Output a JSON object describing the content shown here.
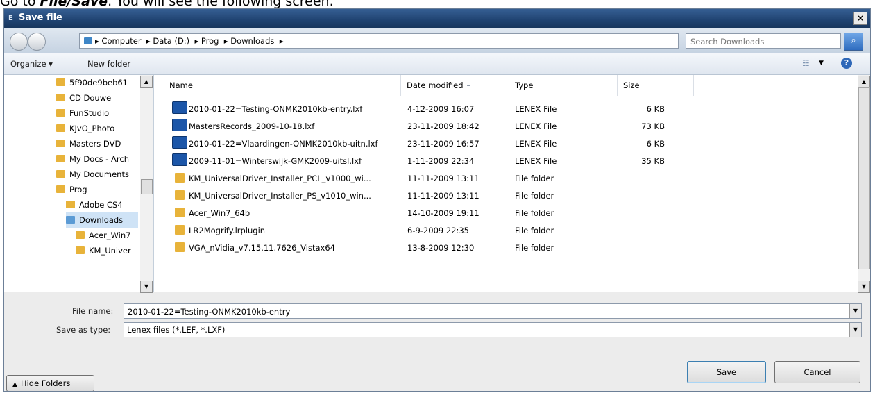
{
  "caption": {
    "prefix": "Go to ",
    "menu": "File/Save",
    "suffix": ". You will see the following screen."
  },
  "window": {
    "title": "Save file",
    "close": "×"
  },
  "address": {
    "crumbs": [
      "▸ Computer",
      "▸ Data (D:)",
      "▸ Prog",
      "▸ Downloads",
      "▸"
    ],
    "search_placeholder": "Search Downloads"
  },
  "toolbar": {
    "organize": "Organize ▾",
    "new_folder": "New folder",
    "help": "?"
  },
  "nav_tree": [
    {
      "label": "5f90de9beb61",
      "selected": false
    },
    {
      "label": "CD Douwe",
      "selected": false
    },
    {
      "label": "FunStudio",
      "selected": false
    },
    {
      "label": "KJvO_Photo",
      "selected": false
    },
    {
      "label": "Masters DVD",
      "selected": false
    },
    {
      "label": "My Docs - Arch",
      "selected": false
    },
    {
      "label": "My Documents",
      "selected": false
    },
    {
      "label": "Prog",
      "selected": false
    },
    {
      "label": "Adobe CS4",
      "selected": false
    },
    {
      "label": "Downloads",
      "selected": true
    },
    {
      "label": "Acer_Win7",
      "selected": false
    },
    {
      "label": "KM_Univer",
      "selected": false
    }
  ],
  "columns": {
    "name": "Name",
    "date": "Date modified",
    "type": "Type",
    "size": "Size"
  },
  "files": [
    {
      "name": "2010-01-22=Testing-ONMK2010kb-entry.lxf",
      "date": "4-12-2009 16:07",
      "type": "LENEX File",
      "size": "6 KB",
      "kind": "file"
    },
    {
      "name": "MastersRecords_2009-10-18.lxf",
      "date": "23-11-2009 18:42",
      "type": "LENEX File",
      "size": "73 KB",
      "kind": "file"
    },
    {
      "name": "2010-01-22=Vlaardingen-ONMK2010kb-uitn.lxf",
      "date": "23-11-2009 16:57",
      "type": "LENEX File",
      "size": "6 KB",
      "kind": "file"
    },
    {
      "name": "2009-11-01=Winterswijk-GMK2009-uitsl.lxf",
      "date": "1-11-2009 22:34",
      "type": "LENEX File",
      "size": "35 KB",
      "kind": "file"
    },
    {
      "name": "KM_UniversalDriver_Installer_PCL_v1000_wi...",
      "date": "11-11-2009 13:11",
      "type": "File folder",
      "size": "",
      "kind": "folder"
    },
    {
      "name": "KM_UniversalDriver_Installer_PS_v1010_win...",
      "date": "11-11-2009 13:11",
      "type": "File folder",
      "size": "",
      "kind": "folder"
    },
    {
      "name": "Acer_Win7_64b",
      "date": "14-10-2009 19:11",
      "type": "File folder",
      "size": "",
      "kind": "folder"
    },
    {
      "name": "LR2Mogrify.lrplugin",
      "date": "6-9-2009 22:35",
      "type": "File folder",
      "size": "",
      "kind": "folder"
    },
    {
      "name": "VGA_nVidia_v7.15.11.7626_Vistax64",
      "date": "13-8-2009 12:30",
      "type": "File folder",
      "size": "",
      "kind": "folder"
    }
  ],
  "form": {
    "file_name_label": "File name:",
    "file_name_value": "2010-01-22=Testing-ONMK2010kb-entry",
    "save_type_label": "Save as type:",
    "save_type_value": "Lenex files (*.LEF, *.LXF)"
  },
  "buttons": {
    "hide_folders": "Hide Folders",
    "save": "Save",
    "cancel": "Cancel"
  }
}
